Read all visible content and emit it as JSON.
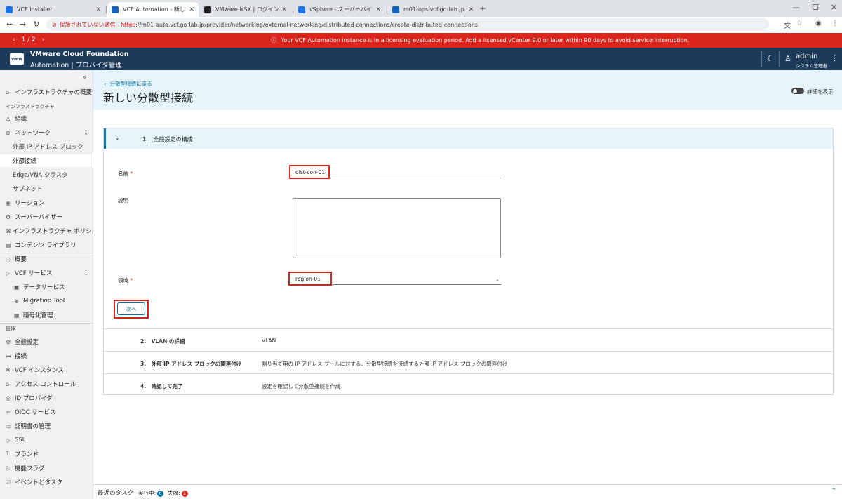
{
  "browser": {
    "tabs": [
      {
        "title": "VCF Installer",
        "color": "#1a73e8"
      },
      {
        "title": "VCF Automation - 新しい分散型",
        "color": "#1565c0"
      },
      {
        "title": "VMware NSX | ログイン",
        "color": "#222222"
      },
      {
        "title": "vSphere - スーパーバイザー",
        "color": "#1a73e8"
      },
      {
        "title": "m01-ops.vcf.go-lab.jp/ui/login",
        "color": "#1565c0"
      }
    ],
    "security_label": "保護されていない通信",
    "url_scheme": "https",
    "url_rest": "://m01-auto.vcf.go-lab.jp/provider/networking/external-networking/distributed-connections/create-distributed-connections"
  },
  "banner": {
    "pager": "1 / 2",
    "message": "Your VCF Automation instance is in a licensing evaluation period. Add a licensed vCenter 9.0 or later within 90 days to avoid service interruption."
  },
  "header": {
    "logo": "vmw",
    "product": "VMware Cloud Foundation",
    "subtitle": "Automation | プロバイダ管理",
    "user_name": "admin",
    "user_role": "システム管理者"
  },
  "sidebar": {
    "overview": "インフラストラクチャの概要",
    "section_infra": "インフラストラクチャ",
    "org": "組織",
    "network": "ネットワーク",
    "ext_ip_blocks": "外部 IP アドレス ブロック",
    "ext_connections": "外部接続",
    "edge_vna": "Edge/VNA クラスタ",
    "subnets": "サブネット",
    "regions": "リージョン",
    "supervisor": "スーパーバイザー",
    "infra_policy": "インフラストラクチャ ポリシ...",
    "content_library": "コンテンツ ライブラリ",
    "summary": "概要",
    "vcf_services": "VCF サービス",
    "data_services": "データサービス",
    "migration_tool": "Migration Tool",
    "encryption": "暗号化管理",
    "section_admin": "管理",
    "general_settings": "全般設定",
    "connections": "接続",
    "vcf_instances": "VCF インスタンス",
    "access_control": "アクセス コントロール",
    "id_providers": "ID プロバイダ",
    "oidc_services": "OIDC サービス",
    "cert_mgmt": "証明書の管理",
    "ssl": "SSL",
    "branding": "ブランド",
    "feature_flags": "機能フラグ",
    "events_tasks": "イベントとタスク"
  },
  "main": {
    "back_link": "分散型接続に戻る",
    "title": "新しい分散型接続",
    "detail_toggle": "詳細を表示",
    "step1": "1.　全般設定の構成",
    "name_label": "名前",
    "name_value": "dist-con-01",
    "description_label": "説明",
    "description_value": "",
    "region_label": "領域",
    "region_value": "region-01",
    "next_button": "次へ",
    "steps": [
      {
        "num": "2.　VLAN の詳細",
        "desc": "VLAN"
      },
      {
        "num": "3.　外部 IP アドレス ブロックの関連付け",
        "desc": "割り当て用の IP アドレス プールに対する、分散型接続を接続する外部 IP アドレス ブロックの関連付け"
      },
      {
        "num": "4.　確認して完了",
        "desc": "設定を確認して分散型接続を作成"
      }
    ]
  },
  "taskbar": {
    "title": "最近のタスク",
    "running_label": "実行中:",
    "running_count": "0",
    "failed_label": "失敗:",
    "failed_count": "2"
  },
  "colors": {
    "banner": "#d9251c",
    "header": "#1c3a5a",
    "accent": "#0072a3",
    "highlight": "#d9251c"
  }
}
